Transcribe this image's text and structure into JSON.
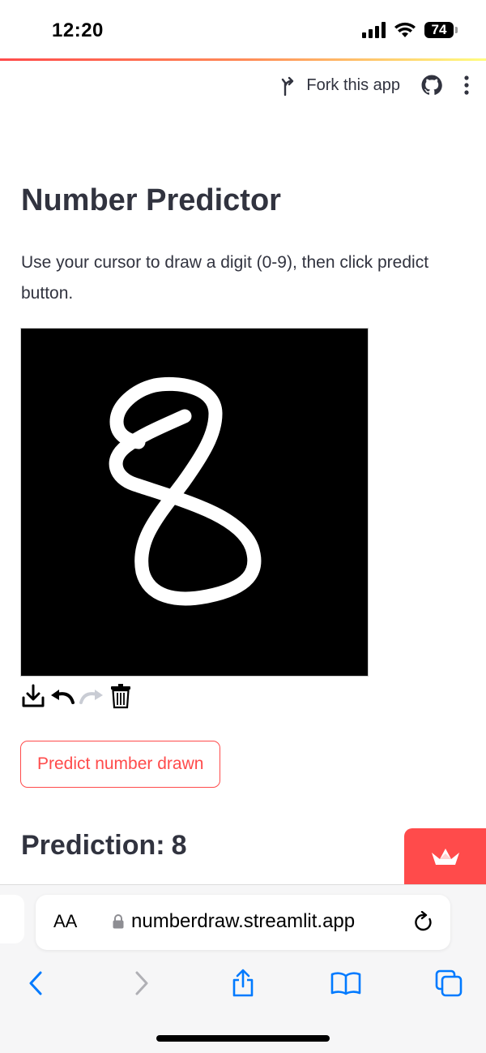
{
  "status": {
    "time": "12:20",
    "battery": "74"
  },
  "header": {
    "fork_label": "Fork this app"
  },
  "main": {
    "title": "Number Predictor",
    "description": "Use your cursor to draw a digit (0-9), then click predict button.",
    "predict_button": "Predict number drawn",
    "prediction_label": "Prediction:",
    "prediction_value": "8"
  },
  "browser": {
    "text_size_label": "AA",
    "url": "numberdraw.streamlit.app"
  },
  "colors": {
    "accent": "#ff4b4b",
    "text": "#31333f",
    "ios_blue": "#007aff"
  }
}
